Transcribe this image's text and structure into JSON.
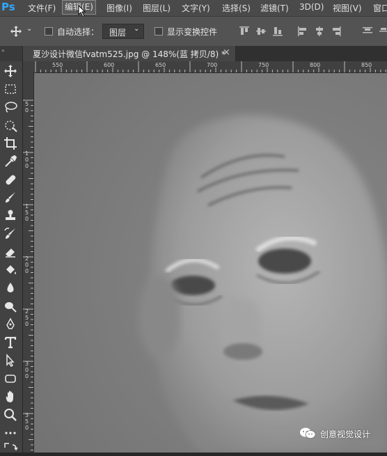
{
  "app": {
    "logo": "Ps"
  },
  "menu": [
    "文件(F)",
    "编辑(E)",
    "图像(I)",
    "图层(L)",
    "文字(Y)",
    "选择(S)",
    "滤镜(T)",
    "3D(D)",
    "视图(V)",
    "窗口"
  ],
  "options": {
    "auto_select_label": "自动选择：",
    "layer_value": "图层",
    "show_transform_label": "显示变换控件"
  },
  "document": {
    "tab_title": "夏沙设计微信fvatm525.jpg @ 148%(蓝 拷贝/8) *",
    "close_glyph": "×",
    "zoom": "148%"
  },
  "ruler": {
    "h_labels": [
      "550",
      "600",
      "650",
      "700",
      "750",
      "800",
      "850"
    ],
    "v_labels": [
      [
        "5",
        "0"
      ],
      [
        "1",
        "0",
        "0"
      ],
      [
        "1",
        "5",
        "0"
      ],
      [
        "2",
        "0",
        "0"
      ],
      [
        "2",
        "5",
        "0"
      ],
      [
        "3",
        "0",
        "0"
      ],
      [
        "3",
        "5",
        "0"
      ]
    ]
  },
  "tools": [
    "move-icon",
    "marquee-icon",
    "lasso-icon",
    "quick-select-icon",
    "crop-icon",
    "eyedropper-icon",
    "healing-icon",
    "brush-icon",
    "stamp-icon",
    "history-brush-icon",
    "eraser-icon",
    "paint-bucket-icon",
    "blur-icon",
    "dodge-icon",
    "pen-icon",
    "type-icon",
    "path-select-icon",
    "shape-icon",
    "hand-icon",
    "zoom-icon",
    "more-icon",
    "swap-colors-icon"
  ],
  "watermark": {
    "text": "创意视觉设计"
  },
  "colors": {
    "menubar": "#4a4a4a",
    "toolbar": "#424242",
    "canvas_bg": "#7a7a7a",
    "ps_blue": "#31a8ff"
  }
}
